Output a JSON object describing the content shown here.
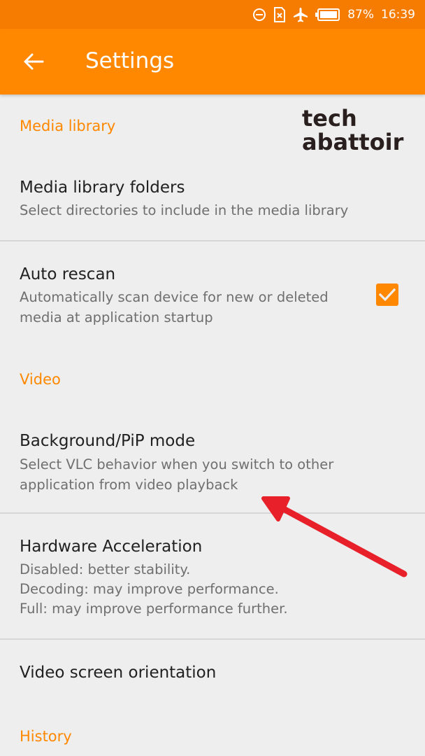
{
  "status_bar": {
    "battery": "87%",
    "time": "16:39",
    "icons": [
      "do-not-disturb-icon",
      "no-sim-icon",
      "airplane-mode-icon",
      "battery-icon"
    ]
  },
  "app_bar": {
    "back_icon": "arrow-left-icon",
    "title": "Settings"
  },
  "watermark": {
    "line1": "tech",
    "line2": "abattoir"
  },
  "sections": {
    "media_library": "Media library",
    "video": "Video",
    "history": "History"
  },
  "items": {
    "media_library_folders": {
      "title": "Media library folders",
      "summary": "Select directories to include in the media library"
    },
    "auto_rescan": {
      "title": "Auto rescan",
      "summary": "Automatically scan device for new or deleted media at application startup",
      "checked": true
    },
    "background_pip": {
      "title": "Background/PiP mode",
      "summary": "Select VLC behavior when you switch to other application from video playback"
    },
    "hardware_acceleration": {
      "title": "Hardware Acceleration",
      "summary_lines": [
        "Disabled: better stability.",
        "Decoding: may improve performance.",
        "Full: may improve performance further."
      ]
    },
    "video_orientation": {
      "title": "Video screen orientation"
    }
  },
  "colors": {
    "accent": "#ff8800",
    "status_bar": "#f57c00",
    "annotation_arrow": "#e8202a"
  }
}
